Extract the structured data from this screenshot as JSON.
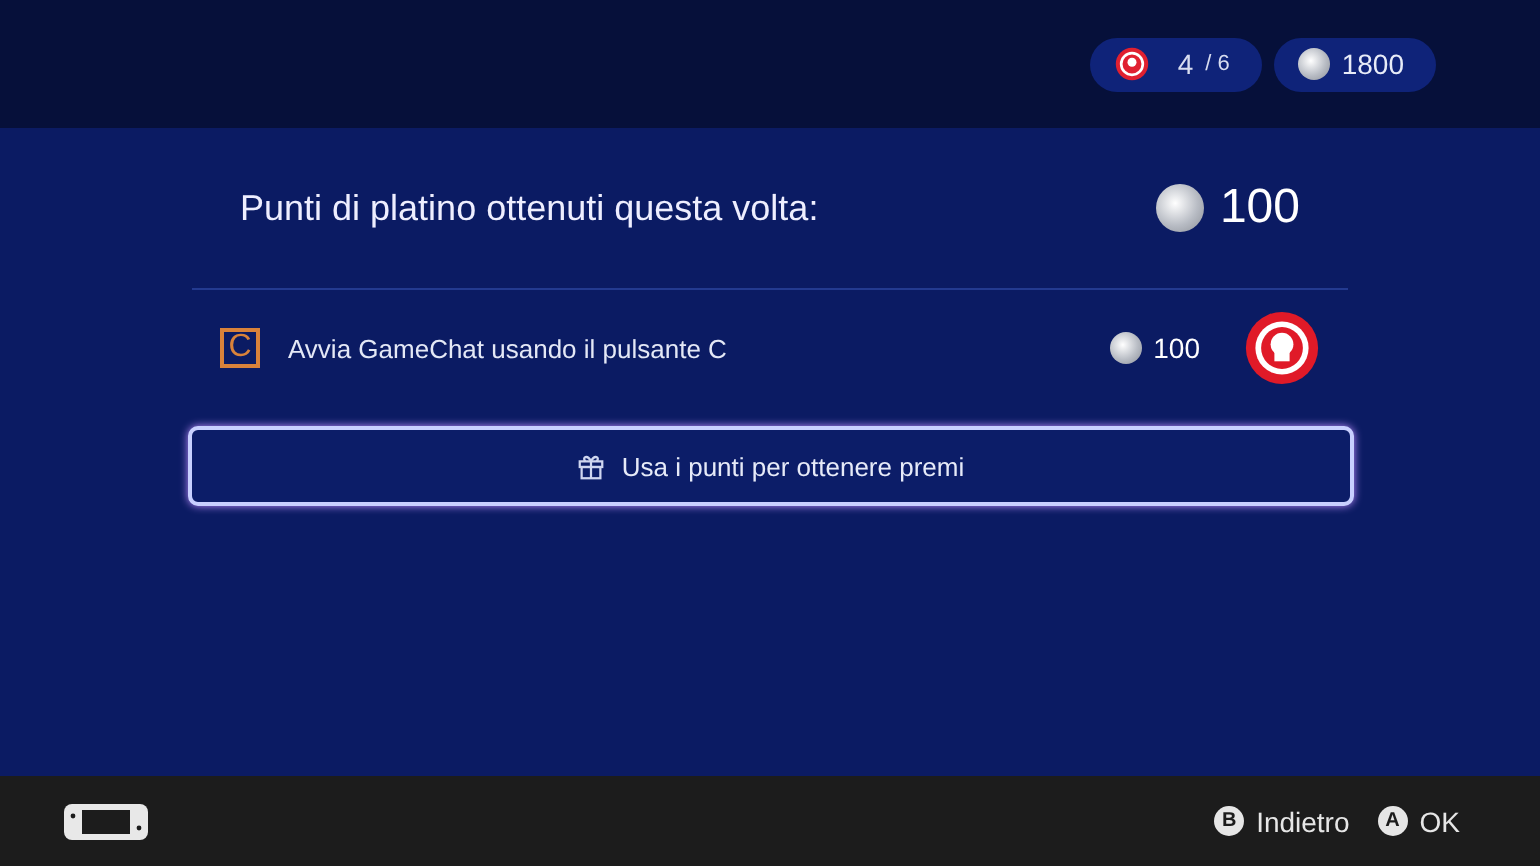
{
  "header": {
    "stamps": {
      "count": "4",
      "total": "/ 6"
    },
    "points": "1800"
  },
  "summary": {
    "label": "Punti di platino ottenuti questa volta:",
    "points": "100"
  },
  "missions": [
    {
      "key": "C",
      "text": "Avvia GameChat usando il pulsante C",
      "points": "100"
    }
  ],
  "reward_button": {
    "label": "Usa i punti per ottenere premi"
  },
  "footer": {
    "buttons": [
      {
        "key": "B",
        "label": "Indietro"
      },
      {
        "key": "A",
        "label": "OK"
      }
    ]
  }
}
